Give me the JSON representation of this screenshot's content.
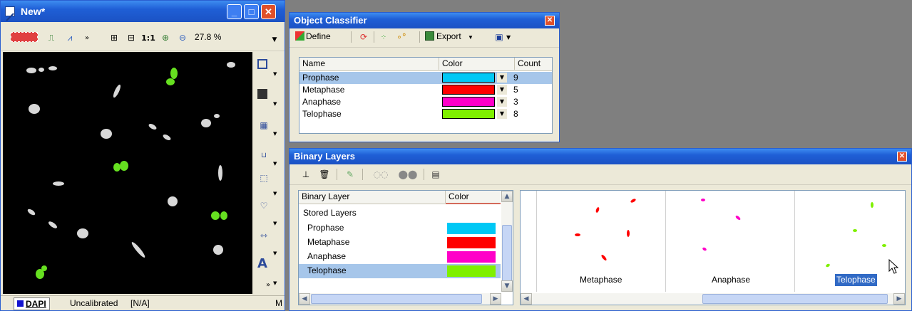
{
  "image_window": {
    "title": "New*",
    "zoom": "27.8 %",
    "scale_label": "1:1",
    "channel_tab": "DAPI",
    "status": "Uncalibrated",
    "status_value": "[N/A]",
    "status_right": "M",
    "text_tool": "A"
  },
  "classifier": {
    "title": "Object Classifier",
    "define_label": "Define",
    "export_label": "Export",
    "columns": [
      "Name",
      "Color",
      "Count"
    ],
    "rows": [
      {
        "name": "Prophase",
        "color": "#00c8f5",
        "count": "9"
      },
      {
        "name": "Metaphase",
        "color": "#ff0000",
        "count": "5"
      },
      {
        "name": "Anaphase",
        "color": "#ff00c8",
        "count": "3"
      },
      {
        "name": "Telophase",
        "color": "#7ff000",
        "count": "8"
      }
    ]
  },
  "binary": {
    "title": "Binary Layers",
    "columns": [
      "Binary Layer",
      "Color"
    ],
    "group_label": "Stored Layers",
    "layers": [
      {
        "name": "Prophase",
        "color": "#00c8f5"
      },
      {
        "name": "Metaphase",
        "color": "#ff0000"
      },
      {
        "name": "Anaphase",
        "color": "#ff00c8"
      },
      {
        "name": "Telophase",
        "color": "#7ff000"
      }
    ],
    "thumbnails": [
      "Metaphase",
      "Anaphase",
      "Telophase"
    ]
  }
}
